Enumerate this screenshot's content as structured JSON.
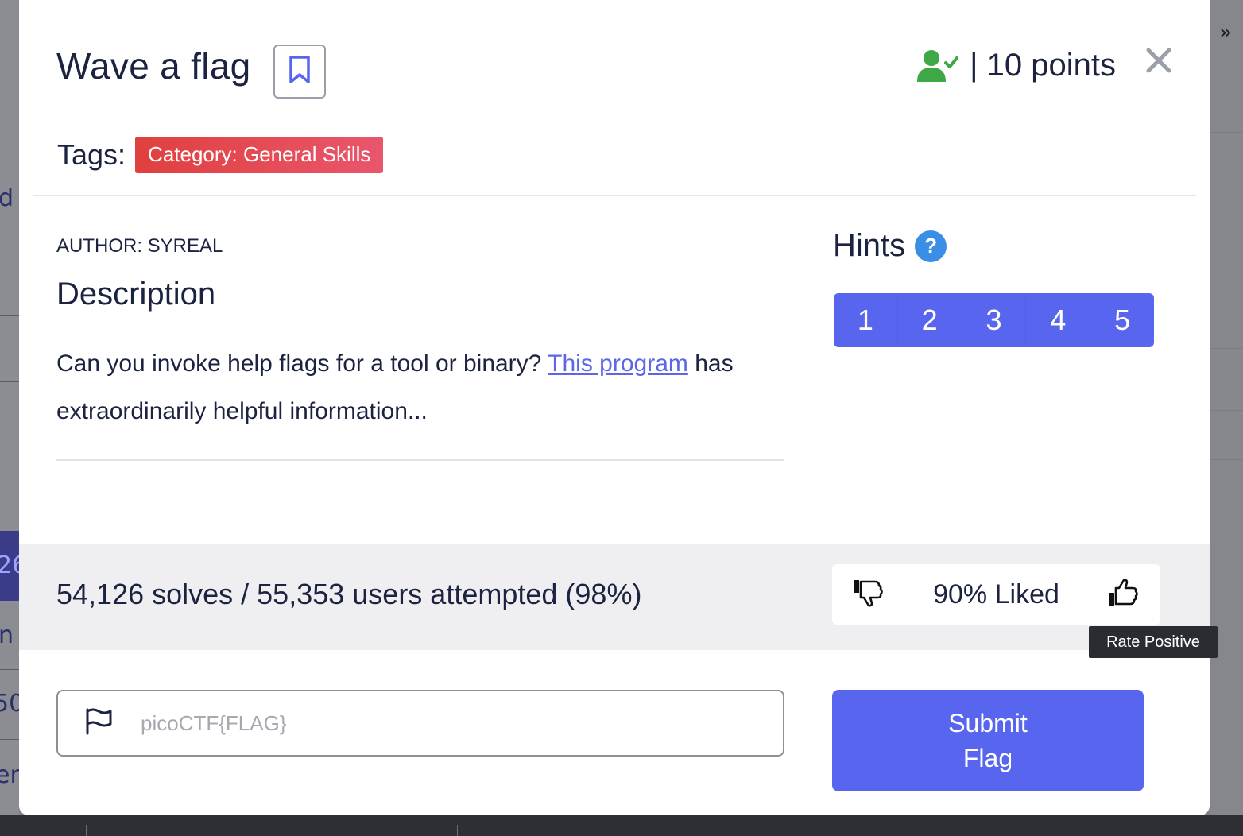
{
  "background": {
    "left_fragments": [
      "d",
      "26",
      "n",
      "50",
      "er"
    ],
    "chevron": "»"
  },
  "modal": {
    "title": "Wave a flag",
    "points": "| 10 points",
    "tags_label": "Tags:",
    "tags": [
      "Category: General Skills"
    ],
    "author": "AUTHOR: SYREAL",
    "description_heading": "Description",
    "description_before": "Can you invoke help flags for a tool or binary? ",
    "description_link": "This program",
    "description_after": " has extraordinarily helpful information...",
    "hints_heading": "Hints",
    "hints_help": "?",
    "hints": [
      "1",
      "2",
      "3",
      "4",
      "5"
    ],
    "solves": "54,126 solves / 55,353 users attempted (98%)",
    "liked": "90% Liked",
    "tooltip": "Rate Positive",
    "flag_placeholder": "picoCTF{FLAG}",
    "submit_label": "Submit Flag"
  },
  "colors": {
    "accent": "#5865ee",
    "tag": "#e0403e",
    "solved_icon": "#3da845",
    "link": "#5b67e8"
  }
}
